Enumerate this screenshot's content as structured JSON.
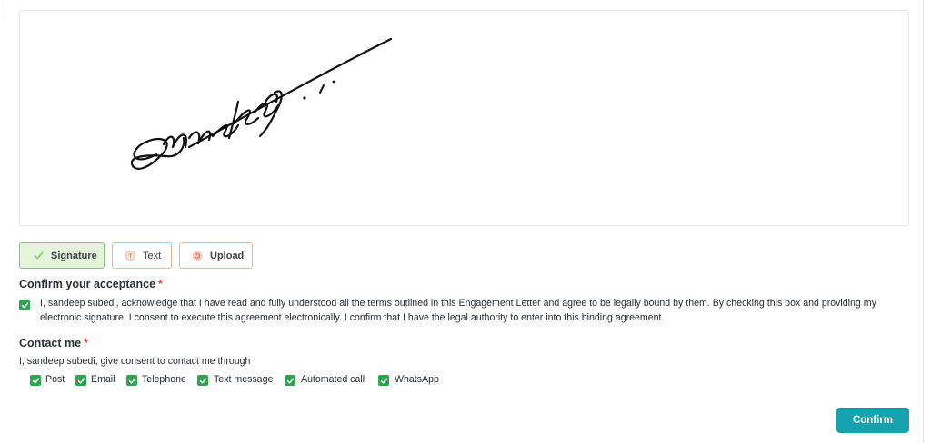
{
  "signature_modes": {
    "signature_label": "Signature",
    "text_label": "Text",
    "upload_label": "Upload"
  },
  "acceptance": {
    "title": "Confirm your acceptance",
    "required_mark": "*",
    "checked": true,
    "text": "I, sandeep subedi, acknowledge that I have read and fully understood all the terms outlined in this Engagement Letter and agree to be legally bound by them. By checking this box and providing my electronic signature, I consent to execute this agreement electronically. I confirm that I have the legal authority to enter into this binding agreement."
  },
  "contact": {
    "title": "Contact me",
    "required_mark": "*",
    "consent_text": "I, sandeep subedi, give consent to contact me through",
    "options": [
      {
        "label": "Post",
        "checked": true
      },
      {
        "label": "Email",
        "checked": true
      },
      {
        "label": "Telephone",
        "checked": true
      },
      {
        "label": "Text message",
        "checked": true
      },
      {
        "label": "Automated call",
        "checked": true
      },
      {
        "label": "WhatsApp",
        "checked": true
      }
    ]
  },
  "confirm_label": "Confirm",
  "colors": {
    "accent": "#16a1ac",
    "checkbox": "#2ea44f",
    "required": "#e53935",
    "signature_active_bg": "#e4f5dc",
    "mode_border": "#f0b38c"
  },
  "icons": {
    "signature": "check-pen-icon",
    "text": "text-icon",
    "upload": "upload-icon",
    "checkbox": "check-icon"
  }
}
